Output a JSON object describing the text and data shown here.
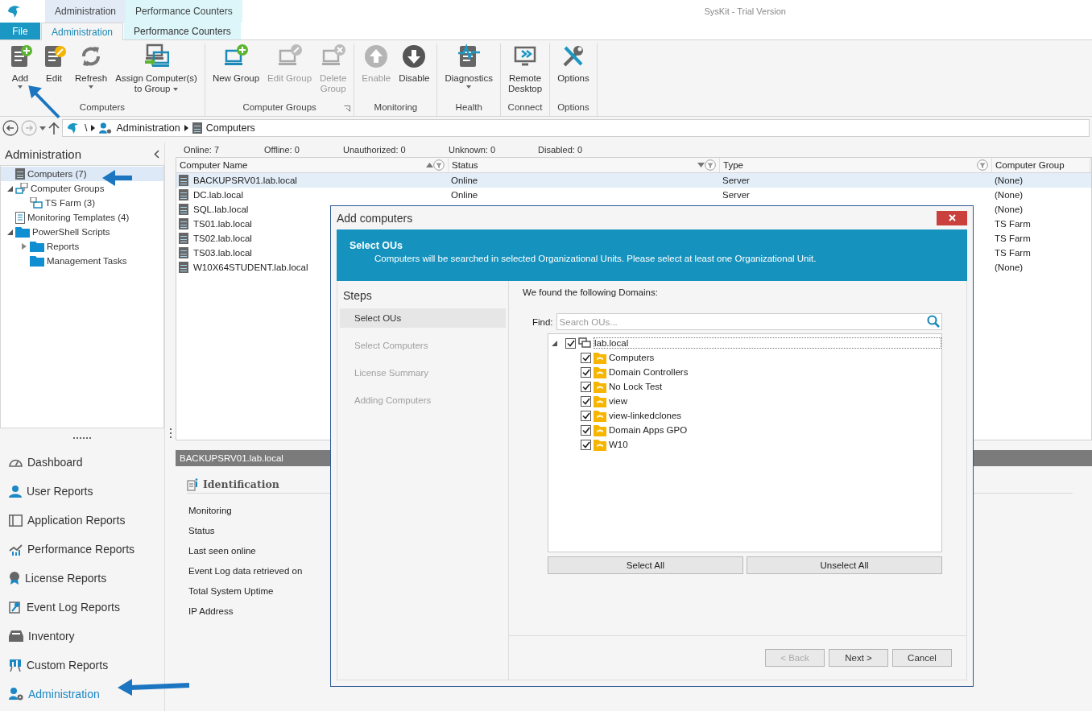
{
  "app": {
    "title": "SysKit - Trial Version"
  },
  "context_tabs": [
    {
      "label": "Administration",
      "color": "#e3ebf6"
    },
    {
      "label": "Performance Counters",
      "color": "#dcf6fa"
    }
  ],
  "ribbon_tabs": [
    {
      "label": "File",
      "kind": "file",
      "selected": false
    },
    {
      "label": "Administration",
      "kind": "tab",
      "selected": true
    },
    {
      "label": "Performance Counters",
      "kind": "context",
      "selected": false
    }
  ],
  "ribbon_groups": [
    {
      "label": "Computers",
      "launcher": false,
      "buttons": [
        {
          "label": [
            "Add"
          ],
          "dropdown": true,
          "disabled": false
        },
        {
          "label": [
            "Edit"
          ],
          "dropdown": false,
          "disabled": false
        },
        {
          "label": [
            "Refresh"
          ],
          "dropdown": true,
          "disabled": false
        },
        {
          "label": [
            "Assign Computer(s)",
            "to Group"
          ],
          "dropdown": true,
          "disabled": false
        }
      ]
    },
    {
      "label": "Computer Groups",
      "launcher": true,
      "buttons": [
        {
          "label": [
            "New Group"
          ],
          "dropdown": false,
          "disabled": false
        },
        {
          "label": [
            "Edit Group"
          ],
          "dropdown": false,
          "disabled": true
        },
        {
          "label": [
            "Delete",
            "Group"
          ],
          "dropdown": false,
          "disabled": true
        }
      ]
    },
    {
      "label": "Monitoring",
      "launcher": false,
      "buttons": [
        {
          "label": [
            "Enable"
          ],
          "dropdown": false,
          "disabled": true
        },
        {
          "label": [
            "Disable"
          ],
          "dropdown": false,
          "disabled": false
        }
      ]
    },
    {
      "label": "Health",
      "launcher": false,
      "buttons": [
        {
          "label": [
            "Diagnostics"
          ],
          "dropdown": true,
          "disabled": false
        }
      ]
    },
    {
      "label": "Connect",
      "launcher": false,
      "buttons": [
        {
          "label": [
            "Remote",
            "Desktop"
          ],
          "dropdown": false,
          "disabled": false
        }
      ]
    },
    {
      "label": "Options",
      "launcher": false,
      "buttons": [
        {
          "label": [
            "Options"
          ],
          "dropdown": false,
          "disabled": false
        }
      ]
    }
  ],
  "navigation": {
    "back_disabled": false,
    "forward_disabled": true
  },
  "breadcrumb": [
    "\\",
    "Administration",
    "Computers"
  ],
  "sidebar": {
    "title": "Administration",
    "tree": [
      {
        "label": "Computers (7)",
        "selected": true
      },
      {
        "label": "Computer Groups",
        "selected": false,
        "expanded": true,
        "children": [
          {
            "label": "TS Farm (3)",
            "selected": false
          }
        ]
      },
      {
        "label": "Monitoring Templates (4)",
        "selected": false
      },
      {
        "label": "PowerShell Scripts",
        "selected": false,
        "expanded": true,
        "children": [
          {
            "label": "Reports",
            "selected": false,
            "expanded": false
          },
          {
            "label": "Management Tasks",
            "selected": false
          }
        ]
      }
    ],
    "nav": [
      {
        "label": "Dashboard",
        "selected": false
      },
      {
        "label": "User Reports",
        "selected": false
      },
      {
        "label": "Application Reports",
        "selected": false
      },
      {
        "label": "Performance Reports",
        "selected": false
      },
      {
        "label": "License Reports",
        "selected": false
      },
      {
        "label": "Event Log Reports",
        "selected": false
      },
      {
        "label": "Inventory",
        "selected": false
      },
      {
        "label": "Custom Reports",
        "selected": false
      },
      {
        "label": "Administration",
        "selected": true
      }
    ]
  },
  "status_counts": [
    "Online: 7",
    "Offline: 0",
    "Unauthorized: 0",
    "Unknown: 0",
    "Disabled: 0"
  ],
  "table": {
    "columns": [
      {
        "label": "Computer Name",
        "sort_up": true,
        "sort_down": false,
        "filter": true
      },
      {
        "label": "Status",
        "sort_up": false,
        "sort_down": true,
        "filter": true
      },
      {
        "label": "Type",
        "sort_up": false,
        "sort_down": false,
        "filter": true
      },
      {
        "label": "Computer Group",
        "sort_up": false,
        "sort_down": false,
        "filter": false
      }
    ],
    "rows": [
      {
        "name": "BACKUPSRV01.lab.local",
        "status": "Online",
        "type": "Server",
        "group": "(None)",
        "selected": true
      },
      {
        "name": "DC.lab.local",
        "status": "Online",
        "type": "Server",
        "group": "(None)",
        "selected": false
      },
      {
        "name": "SQL.lab.local",
        "group": "(None)",
        "selected": false
      },
      {
        "name": "TS01.lab.local",
        "group": "TS Farm",
        "selected": false
      },
      {
        "name": "TS02.lab.local",
        "group": "TS Farm",
        "selected": false
      },
      {
        "name": "TS03.lab.local",
        "group": "TS Farm",
        "selected": false
      },
      {
        "name": "W10X64STUDENT.lab.local",
        "group": "(None)",
        "selected": false
      }
    ]
  },
  "details": {
    "title": "BACKUPSRV01.lab.local",
    "section": "Identification",
    "fields": [
      "Monitoring",
      "Status",
      "Last seen online",
      "Event Log data retrieved on",
      "Total System Uptime",
      "IP Address"
    ]
  },
  "dialog": {
    "title": "Add computers",
    "banner_title": "Select OUs",
    "banner_text": "Computers will be searched in selected Organizational Units. Please select at least one Organizational Unit.",
    "steps_title": "Steps",
    "steps": [
      {
        "label": "Select OUs",
        "selected": true
      },
      {
        "label": "Select Computers",
        "selected": false
      },
      {
        "label": "License Summary",
        "selected": false
      },
      {
        "label": "Adding Computers",
        "selected": false
      }
    ],
    "found_label": "We found the following Domains:",
    "find_label": "Find:",
    "find_placeholder": "Search OUs...",
    "tree": {
      "label": "lab.local",
      "checked": true,
      "expanded": true,
      "children": [
        {
          "label": "Computers",
          "checked": true
        },
        {
          "label": "Domain Controllers",
          "checked": true
        },
        {
          "label": "No Lock Test",
          "checked": true
        },
        {
          "label": "view",
          "checked": true
        },
        {
          "label": "view-linkedclones",
          "checked": true
        },
        {
          "label": "Domain Apps GPO",
          "checked": true
        },
        {
          "label": "W10",
          "checked": true
        }
      ]
    },
    "select_all": "Select All",
    "unselect_all": "Unselect All",
    "buttons": [
      {
        "label": "< Back",
        "disabled": true
      },
      {
        "label": "Next >",
        "disabled": false
      },
      {
        "label": "Cancel",
        "disabled": false
      }
    ]
  }
}
